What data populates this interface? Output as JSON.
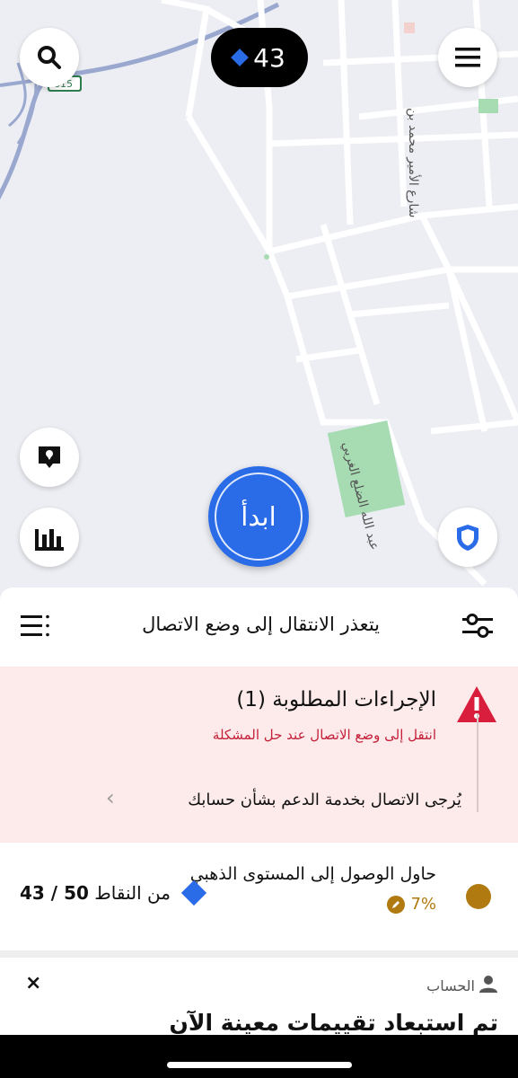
{
  "map": {
    "highway_shield": "615",
    "street_labels": [
      "شارع الأمير محمد بن",
      "عبد الله الضلع الغربي"
    ]
  },
  "top_bar": {
    "points_value": "43",
    "search_icon": "search-icon",
    "menu_icon": "hamburger-menu-icon"
  },
  "go_button": {
    "label": "ابدأ"
  },
  "side_buttons": {
    "location_report": "map-pin-chat-icon",
    "earnings": "bar-chart-icon",
    "safety": "shield-icon"
  },
  "sheet": {
    "status_text": "يتعذر الانتقال إلى وضع الاتصال",
    "alert": {
      "title": "الإجراءات المطلوبة (1)",
      "subtitle": "انتقل إلى وضع الاتصال عند حل المشكلة",
      "support_text": "يُرجى الاتصال بخدمة الدعم بشأن حسابك"
    },
    "level": {
      "title": "حاول الوصول إلى المستوى الذهبي",
      "progress_text": "7%",
      "progress_fraction": 0.07,
      "points_current": "43",
      "points_sep": " / ",
      "points_goal": "50",
      "points_unit": "من النقاط"
    },
    "card": {
      "label": "الحساب",
      "headline": "تم استبعاد تقييمات معينة الآن",
      "close": "×"
    }
  },
  "colors": {
    "accent_blue": "#2a6be8",
    "alert_red": "#c4203a",
    "alert_bg": "#fdeaea",
    "gold": "#b07a10"
  }
}
